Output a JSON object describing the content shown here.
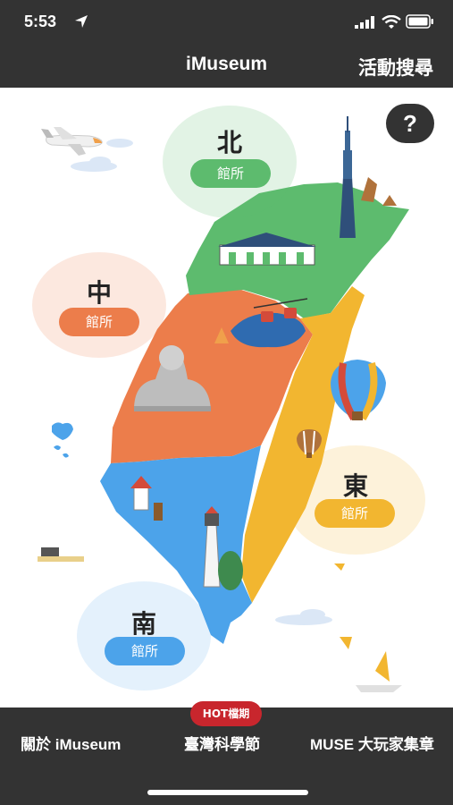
{
  "status": {
    "time": "5:53"
  },
  "nav": {
    "title": "iMuseum",
    "action": "活動搜尋"
  },
  "help": {
    "label": "?"
  },
  "regions": [
    {
      "name": "北",
      "button": "館所",
      "color": "#5dbb6e"
    },
    {
      "name": "中",
      "button": "館所",
      "color": "#ec7d4b"
    },
    {
      "name": "東",
      "button": "館所",
      "color": "#f2b630"
    },
    {
      "name": "南",
      "button": "館所",
      "color": "#4ca3ea"
    }
  ],
  "tabs": [
    {
      "label": "關於 iMuseum"
    },
    {
      "label": "臺灣科學節",
      "badge": "HOT檔期"
    },
    {
      "label": "MUSE 大玩家集章"
    }
  ]
}
